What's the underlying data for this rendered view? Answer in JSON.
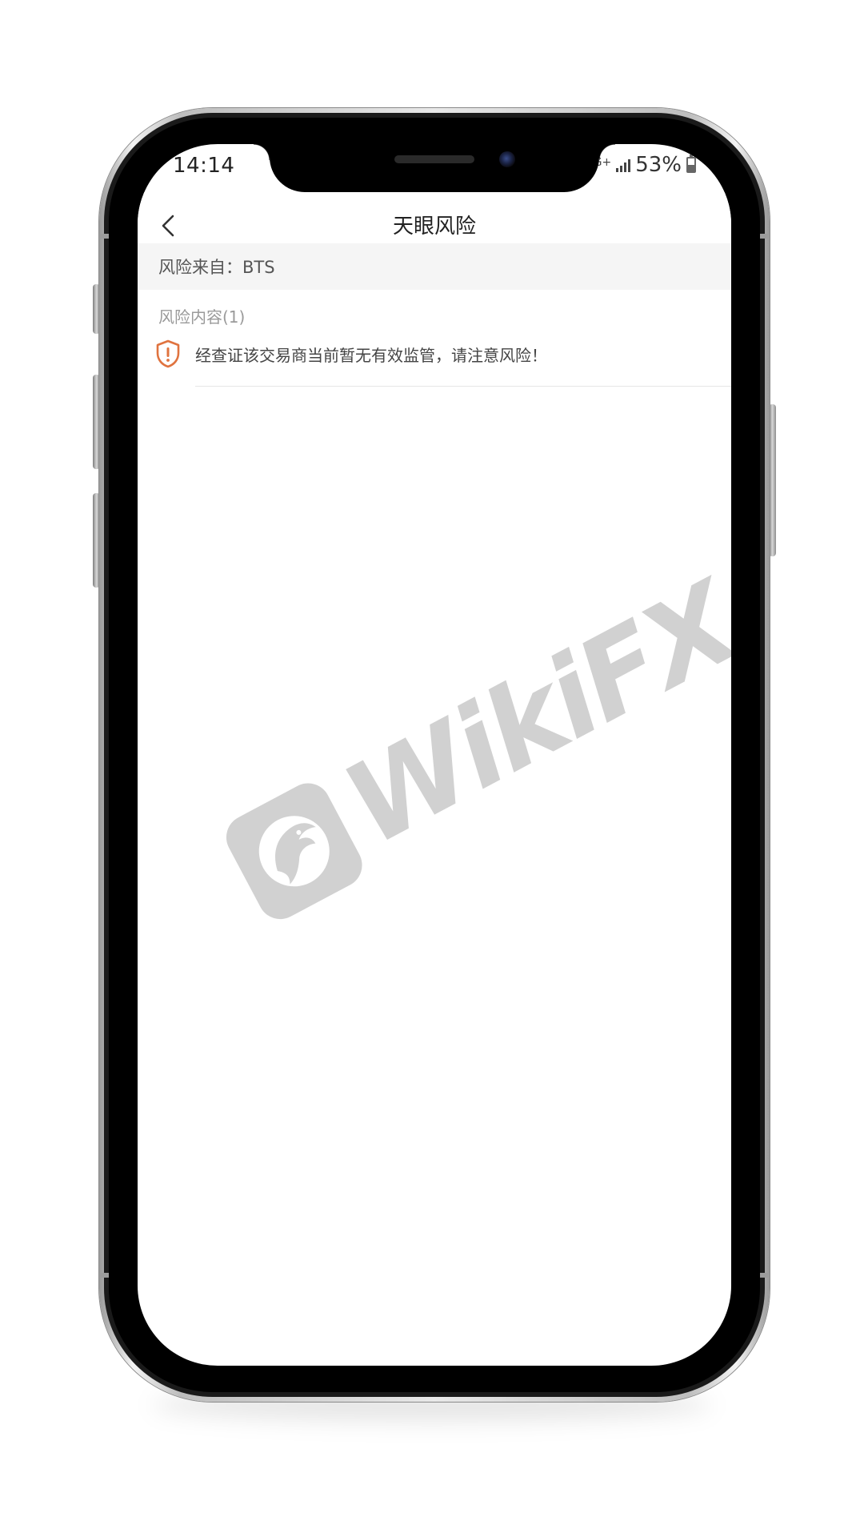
{
  "status_bar": {
    "time": "14:14",
    "network": "G+",
    "battery_percent_label": "53%",
    "battery_level": 0.53
  },
  "nav": {
    "title": "天眼风险",
    "back_icon": "chevron-left-icon"
  },
  "risk": {
    "source_label": "风险来自：BTS",
    "section_label": "风险内容(1)",
    "items": [
      {
        "icon": "shield-alert-icon",
        "text": "经查证该交易商当前暂无有效监管，请注意风险！"
      }
    ]
  },
  "watermark": {
    "text": "WikiFX",
    "icon": "eagle-logo-icon"
  },
  "colors": {
    "accent_warning": "#e0733f",
    "watermark_gray": "#cfcfcf",
    "source_row_bg": "#f5f5f5"
  }
}
